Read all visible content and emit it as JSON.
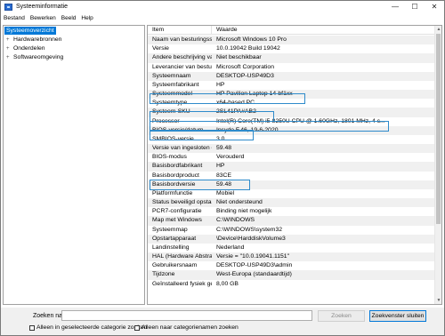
{
  "window": {
    "title": "Systeeminformatie",
    "controls": {
      "minimize": "—",
      "maximize": "☐",
      "close": "✕"
    }
  },
  "menu": [
    "Bestand",
    "Bewerken",
    "Beeld",
    "Help"
  ],
  "tree": {
    "root": "Systeemoverzicht",
    "children": [
      {
        "label": "Hardwarebronnen",
        "expander": "+"
      },
      {
        "label": "Onderdelen",
        "expander": "+"
      },
      {
        "label": "Softwareomgeving",
        "expander": "+"
      }
    ]
  },
  "list": {
    "headers": {
      "item": "Item",
      "value": "Waarde"
    },
    "rows": [
      {
        "item": "Naam van besturingssy...",
        "value": "Microsoft Windows 10 Pro"
      },
      {
        "item": "Versie",
        "value": "10.0.19042 Build 19042"
      },
      {
        "item": "Andere beschrijving va...",
        "value": "Niet beschikbaar"
      },
      {
        "item": "Leverancier van besturi...",
        "value": "Microsoft Corporation"
      },
      {
        "item": "Systeemnaam",
        "value": "DESKTOP-USP49D3"
      },
      {
        "item": "Systeemfabrikant",
        "value": "HP"
      },
      {
        "item": "Systeemmodel",
        "value": "HP Pavilion Laptop 14-bf1xx"
      },
      {
        "item": "Systeemtype",
        "value": "x64-based PC"
      },
      {
        "item": "Systeem-SKU",
        "value": "2SL41PA#AB2"
      },
      {
        "item": "Processor",
        "value": "Intel(R) Core(TM) i5-8250U CPU @ 1.60GHz, 1801 MHz, 4 c..."
      },
      {
        "item": "BIOS-versie/datum",
        "value": "Insyde F.46, 19-6-2020"
      },
      {
        "item": "SMBIOS-versie",
        "value": "3.0"
      },
      {
        "item": "Versie van ingesloten c...",
        "value": "59.48"
      },
      {
        "item": "BIOS-modus",
        "value": "Verouderd"
      },
      {
        "item": "Basisbordfabrikant",
        "value": "HP"
      },
      {
        "item": "Basisbordproduct",
        "value": "83CE"
      },
      {
        "item": "Basisbordversie",
        "value": "59.48"
      },
      {
        "item": "Platformfunctie",
        "value": "Mobiel"
      },
      {
        "item": "Status beveiligd opstart...",
        "value": "Niet ondersteund"
      },
      {
        "item": "PCR7-configuratie",
        "value": "Binding niet mogelijk"
      },
      {
        "item": "Map met Windows",
        "value": "C:\\WINDOWS"
      },
      {
        "item": "Systeemmap",
        "value": "C:\\WINDOWS\\system32"
      },
      {
        "item": "Opstartapparaat",
        "value": "\\Device\\HarddiskVolume3"
      },
      {
        "item": "Landinstelling",
        "value": "Nederland"
      },
      {
        "item": "HAL (Hardware Abstrac...",
        "value": "Versie = \"10.0.19041.1151\""
      },
      {
        "item": "Gebruikersnaam",
        "value": "DESKTOP-USP49D3\\admin"
      },
      {
        "item": "Tijdzone",
        "value": "West-Europa (standaardtijd)"
      },
      {
        "item": "Geïnstalleerd fysiek geh...",
        "value": "8,00 GB"
      }
    ]
  },
  "search": {
    "label": "Zoeken naar:",
    "value": "",
    "find_button": "Zoeken",
    "close_button": "Zoekvenster sluiten",
    "option_selected_category": "Alleen in geselecteerde categorie zoeken",
    "option_category_names": "Alleen naar categorienamen zoeken"
  },
  "colors": {
    "selection": "#0078d7",
    "highlight_box": "#2e8bcb"
  },
  "icons": {
    "app": "system-info-icon",
    "tree_expander": "plus-expander-icon"
  }
}
